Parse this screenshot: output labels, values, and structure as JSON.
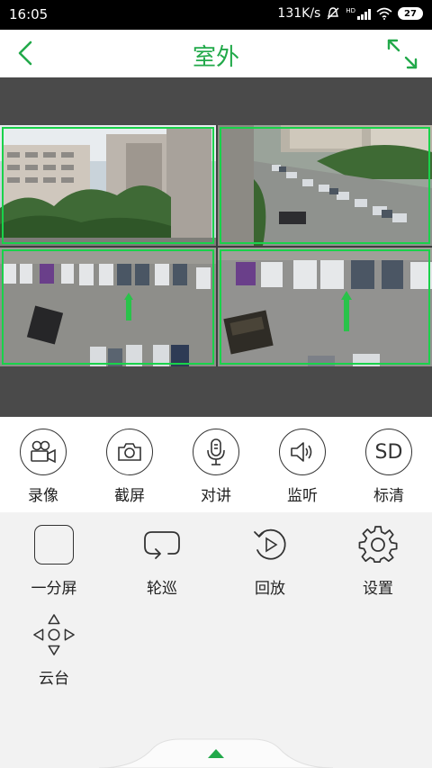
{
  "status_bar": {
    "time": "16:05",
    "network_speed": "131K/s",
    "battery": "27",
    "hd_label": "HD",
    "icons": [
      "mute-icon",
      "signal-icon",
      "wifi-icon",
      "battery-icon"
    ]
  },
  "header": {
    "title": "室外",
    "back_icon": "chevron-left-icon",
    "fullscreen_icon": "expand-icon",
    "accent_color": "#22a94a"
  },
  "video": {
    "layout": "4-split",
    "cameras": [
      {
        "position": "top-left",
        "scene": "apartment buildings and trees"
      },
      {
        "position": "top-right",
        "scene": "parking lot from above"
      },
      {
        "position": "bottom-left",
        "scene": "parking lot with cars"
      },
      {
        "position": "bottom-right",
        "scene": "parking lot close view"
      }
    ],
    "border_color": "#19d24a"
  },
  "controls": [
    {
      "label": "录像",
      "icon": "video-camera-icon"
    },
    {
      "label": "截屏",
      "icon": "camera-icon"
    },
    {
      "label": "对讲",
      "icon": "microphone-icon"
    },
    {
      "label": "监听",
      "icon": "speaker-icon"
    },
    {
      "label": "标清",
      "icon": "sd-icon",
      "icon_text": "SD"
    }
  ],
  "menu": [
    {
      "label": "一分屏",
      "icon": "square-icon"
    },
    {
      "label": "轮巡",
      "icon": "loop-icon"
    },
    {
      "label": "回放",
      "icon": "playback-icon"
    },
    {
      "label": "设置",
      "icon": "gear-icon"
    },
    {
      "label": "云台",
      "icon": "ptz-icon"
    }
  ],
  "bottom": {
    "icon": "expand-up-icon"
  }
}
